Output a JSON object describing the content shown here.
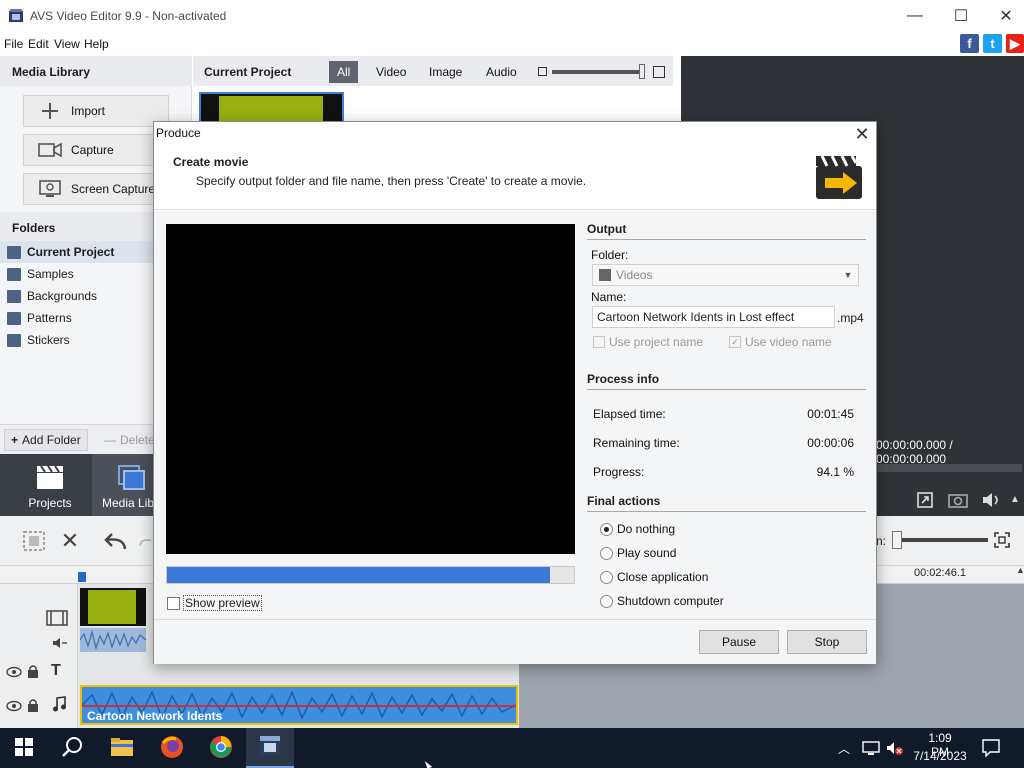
{
  "window": {
    "title": "AVS Video Editor 9.9 - Non-activated"
  },
  "menu": {
    "items": [
      "File",
      "Edit",
      "View",
      "Help"
    ]
  },
  "social": [
    {
      "name": "facebook",
      "glyph": "f",
      "color": "#3b5998"
    },
    {
      "name": "twitter",
      "glyph": "t",
      "color": "#1da1f2"
    },
    {
      "name": "youtube",
      "glyph": "▶",
      "color": "#e62117"
    }
  ],
  "media_library": {
    "title": "Media Library",
    "buttons": {
      "import": "Import",
      "capture": "Capture",
      "screen_capture": "Screen Capture"
    },
    "folders_title": "Folders",
    "folders": [
      "Current Project",
      "Samples",
      "Backgrounds",
      "Patterns",
      "Stickers"
    ],
    "add_folder": "Add Folder",
    "delete": "Delete"
  },
  "current_project": {
    "title": "Current Project",
    "tabs": [
      "All",
      "Video",
      "Image",
      "Audio"
    ]
  },
  "preview": {
    "time": "00:00:00.000 / 00:00:00.000"
  },
  "bottom_nav": {
    "projects": "Projects",
    "media_library": "Media Libr"
  },
  "timeline": {
    "ruler_time": "00:02:46.1",
    "audio_clip_label": "Cartoon Network Idents"
  },
  "taskbar": {
    "time": "1:09 PM",
    "date": "7/14/2023"
  },
  "dialog": {
    "title": "Produce",
    "heading": "Create movie",
    "description": "Specify output folder and file name, then press 'Create' to create a movie.",
    "output": {
      "section": "Output",
      "folder_label": "Folder:",
      "folder_value": "Videos",
      "name_label": "Name:",
      "name_value": "Cartoon Network Idents in Lost effect",
      "extension": ".mp4",
      "use_project_name": "Use project name",
      "use_video_name": "Use video name"
    },
    "process_info": {
      "section": "Process info",
      "elapsed_label": "Elapsed time:",
      "elapsed_value": "00:01:45",
      "remaining_label": "Remaining time:",
      "remaining_value": "00:00:06",
      "progress_label": "Progress:",
      "progress_value": "94.1 %",
      "progress_fraction": 0.941
    },
    "final_actions": {
      "section": "Final actions",
      "options": [
        "Do nothing",
        "Play sound",
        "Close application",
        "Shutdown computer"
      ],
      "selected": 0
    },
    "show_preview": "Show preview",
    "buttons": {
      "pause": "Pause",
      "stop": "Stop"
    }
  }
}
